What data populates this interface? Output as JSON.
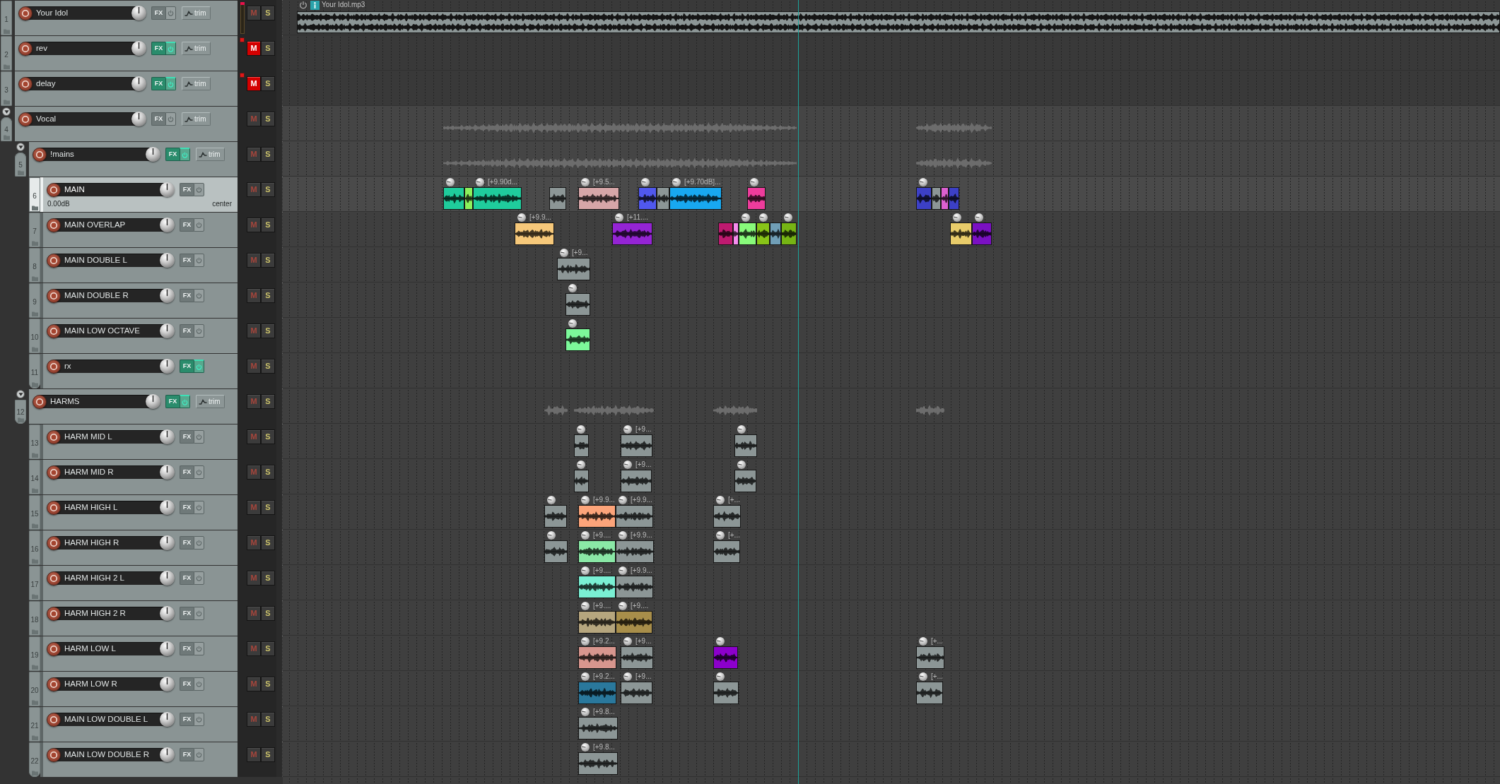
{
  "tracks": [
    {
      "number": "1",
      "name": "Your Idol",
      "selected": false,
      "meter": true,
      "clip": true,
      "fx": {
        "label": "FX",
        "on": false
      },
      "trim": {
        "label": "trim"
      },
      "mute": {
        "label": "M",
        "on": false
      },
      "solo": {
        "label": "S",
        "on": false
      },
      "items": [
        {
          "kind": "take",
          "label": "Your Idol.mp3",
          "color": "#8c9696"
        }
      ]
    },
    {
      "number": "2",
      "name": "rev",
      "selected": false,
      "meter": false,
      "clip": true,
      "fx": {
        "label": "FX",
        "on": true
      },
      "trim": {
        "label": "trim"
      },
      "mute": {
        "label": "M",
        "on": true
      },
      "solo": {
        "label": "S",
        "on": false
      }
    },
    {
      "number": "3",
      "name": "delay",
      "selected": false,
      "meter": false,
      "clip": true,
      "fx": {
        "label": "FX",
        "on": true
      },
      "trim": {
        "label": "trim"
      },
      "mute": {
        "label": "M",
        "on": true
      },
      "solo": {
        "label": "S",
        "on": false
      }
    },
    {
      "number": "4",
      "name": "Vocal",
      "selected": false,
      "expanded": true,
      "meter": false,
      "clip": false,
      "fx": {
        "label": "FX",
        "on": false
      },
      "trim": {
        "label": "trim"
      },
      "mute": {
        "label": "M",
        "on": false
      },
      "solo": {
        "label": "S",
        "on": false
      },
      "children": [
        {
          "number": "5",
          "name": "!mains",
          "selected": false,
          "expanded": true,
          "meter": false,
          "clip": false,
          "fx": {
            "label": "FX",
            "on": true
          },
          "trim": {
            "label": "trim"
          },
          "mute": {
            "label": "M",
            "on": false
          },
          "solo": {
            "label": "S",
            "on": false
          },
          "children": [
            {
              "number": "6",
              "name": "MAIN",
              "selected": true,
              "volume": "0.00dB",
              "pan": "center",
              "meter": false,
              "clip": false,
              "fx": {
                "label": "FX",
                "on": false
              },
              "mute": {
                "label": "M",
                "on": false
              },
              "solo": {
                "label": "S",
                "on": false
              },
              "items": [
                {
                  "kind": "clip",
                  "color": "#1fcc9c"
                },
                {
                  "kind": "segment",
                  "color": "#8cf05c"
                },
                {
                  "kind": "clip",
                  "label": "[+9.90d...",
                  "color": "#1fcc9c"
                },
                {
                  "kind": "segment",
                  "color": "#8c9696"
                },
                {
                  "kind": "clip",
                  "label": "[+9.5...",
                  "color": "#d6a6a8"
                },
                {
                  "kind": "clip",
                  "color": "#5058ee"
                },
                {
                  "kind": "segment",
                  "color": "#8c9696"
                },
                {
                  "kind": "clip",
                  "label": "[+9.70dB]...",
                  "color": "#18a8f0"
                },
                {
                  "kind": "clip",
                  "color": "#ee3c9c"
                },
                {
                  "kind": "clip",
                  "color": "#3c40c6"
                },
                {
                  "kind": "segment",
                  "color": "#8c9696"
                },
                {
                  "kind": "segment",
                  "color": "#dc60d0"
                },
                {
                  "kind": "segment",
                  "color": "#3c40c6"
                }
              ]
            },
            {
              "number": "7",
              "name": "MAIN OVERLAP",
              "selected": false,
              "meter": false,
              "clip": false,
              "fx": {
                "label": "FX",
                "on": false
              },
              "mute": {
                "label": "M",
                "on": false
              },
              "solo": {
                "label": "S",
                "on": false
              },
              "items": [
                {
                  "kind": "clip",
                  "label": "[+9.9...",
                  "color": "#f6c87a"
                },
                {
                  "kind": "clip",
                  "label": "[+11....",
                  "color": "#9424d4"
                },
                {
                  "kind": "segment",
                  "color": "#be1a70"
                },
                {
                  "kind": "segment",
                  "color": "#f68cee"
                },
                {
                  "kind": "clip",
                  "color": "#88fa7a"
                },
                {
                  "kind": "clip",
                  "color": "#88c418"
                },
                {
                  "kind": "segment",
                  "color": "#709eb6"
                },
                {
                  "kind": "clip",
                  "color": "#76b414"
                },
                {
                  "kind": "clip",
                  "color": "#e8cc6a"
                },
                {
                  "kind": "clip",
                  "color": "#7a10c2"
                }
              ]
            },
            {
              "number": "8",
              "name": "MAIN DOUBLE L",
              "selected": false,
              "meter": false,
              "clip": false,
              "fx": {
                "label": "FX",
                "on": false
              },
              "mute": {
                "label": "M",
                "on": false
              },
              "solo": {
                "label": "S",
                "on": false
              },
              "items": [
                {
                  "kind": "clip",
                  "label": "[+9...",
                  "color": "#8c9696"
                }
              ]
            },
            {
              "number": "9",
              "name": "MAIN DOUBLE R",
              "selected": false,
              "meter": false,
              "clip": false,
              "fx": {
                "label": "FX",
                "on": false
              },
              "mute": {
                "label": "M",
                "on": false
              },
              "solo": {
                "label": "S",
                "on": false
              },
              "items": [
                {
                  "kind": "clip",
                  "color": "#8c9696"
                }
              ]
            },
            {
              "number": "10",
              "name": "MAIN LOW OCTAVE",
              "selected": false,
              "meter": false,
              "clip": false,
              "fx": {
                "label": "FX",
                "on": false
              },
              "mute": {
                "label": "M",
                "on": false
              },
              "solo": {
                "label": "S",
                "on": false
              },
              "items": [
                {
                  "kind": "clip",
                  "color": "#7cf89a"
                }
              ]
            },
            {
              "number": "11",
              "name": "rx",
              "selected": false,
              "meter": false,
              "clip": false,
              "fx": {
                "label": "FX",
                "on": true
              },
              "mute": {
                "label": "M",
                "on": false
              },
              "solo": {
                "label": "S",
                "on": false
              }
            }
          ]
        },
        {
          "number": "12",
          "name": "HARMS",
          "selected": false,
          "expanded": true,
          "meter": false,
          "clip": false,
          "fx": {
            "label": "FX",
            "on": true
          },
          "trim": {
            "label": "trim"
          },
          "mute": {
            "label": "M",
            "on": false
          },
          "solo": {
            "label": "S",
            "on": false
          },
          "children": [
            {
              "number": "13",
              "name": "HARM MID L",
              "selected": false,
              "meter": false,
              "clip": false,
              "fx": {
                "label": "FX",
                "on": false
              },
              "mute": {
                "label": "M",
                "on": false
              },
              "solo": {
                "label": "S",
                "on": false
              },
              "items": [
                {
                  "kind": "clip",
                  "color": "#8c9696"
                },
                {
                  "kind": "clip",
                  "label": "[+9...",
                  "color": "#8c9696"
                },
                {
                  "kind": "clip",
                  "color": "#8c9696"
                }
              ]
            },
            {
              "number": "14",
              "name": "HARM MID R",
              "selected": false,
              "meter": false,
              "clip": false,
              "fx": {
                "label": "FX",
                "on": false
              },
              "mute": {
                "label": "M",
                "on": false
              },
              "solo": {
                "label": "S",
                "on": false
              },
              "items": [
                {
                  "kind": "clip",
                  "color": "#8c9696"
                },
                {
                  "kind": "clip",
                  "label": "[+9...",
                  "color": "#8c9696"
                },
                {
                  "kind": "clip",
                  "color": "#8c9696"
                }
              ]
            },
            {
              "number": "15",
              "name": "HARM HIGH L",
              "selected": false,
              "meter": false,
              "clip": false,
              "fx": {
                "label": "FX",
                "on": false
              },
              "mute": {
                "label": "M",
                "on": false
              },
              "solo": {
                "label": "S",
                "on": false
              },
              "items": [
                {
                  "kind": "clip",
                  "color": "#8c9696"
                },
                {
                  "kind": "clip",
                  "label": "[+9.9...",
                  "color": "#fca47a"
                },
                {
                  "kind": "clip",
                  "label": "[+9.9...",
                  "color": "#8c9696"
                },
                {
                  "kind": "clip",
                  "label": "[+...",
                  "color": "#8c9696"
                }
              ]
            },
            {
              "number": "16",
              "name": "HARM HIGH R",
              "selected": false,
              "meter": false,
              "clip": false,
              "fx": {
                "label": "FX",
                "on": false
              },
              "mute": {
                "label": "M",
                "on": false
              },
              "solo": {
                "label": "S",
                "on": false
              },
              "items": [
                {
                  "kind": "clip",
                  "color": "#8c9696"
                },
                {
                  "kind": "clip",
                  "label": "[+9....",
                  "color": "#8ae8a6"
                },
                {
                  "kind": "clip",
                  "label": "[+9.9...",
                  "color": "#8c9696"
                },
                {
                  "kind": "clip",
                  "label": "[+...",
                  "color": "#8c9696"
                }
              ]
            },
            {
              "number": "17",
              "name": "HARM HIGH 2 L",
              "selected": false,
              "meter": false,
              "clip": false,
              "fx": {
                "label": "FX",
                "on": false
              },
              "mute": {
                "label": "M",
                "on": false
              },
              "solo": {
                "label": "S",
                "on": false
              },
              "items": [
                {
                  "kind": "clip",
                  "label": "[+9....",
                  "color": "#7af0d4"
                },
                {
                  "kind": "clip",
                  "label": "[+9.9...",
                  "color": "#8c9696"
                }
              ]
            },
            {
              "number": "18",
              "name": "HARM HIGH 2 R",
              "selected": false,
              "meter": false,
              "clip": false,
              "fx": {
                "label": "FX",
                "on": false
              },
              "mute": {
                "label": "M",
                "on": false
              },
              "solo": {
                "label": "S",
                "on": false
              },
              "items": [
                {
                  "kind": "clip",
                  "label": "[+9....",
                  "color": "#b6a67e"
                },
                {
                  "kind": "clip",
                  "label": "[+9....",
                  "color": "#a88e4a"
                }
              ]
            },
            {
              "number": "19",
              "name": "HARM LOW L",
              "selected": false,
              "meter": false,
              "clip": false,
              "fx": {
                "label": "FX",
                "on": false
              },
              "mute": {
                "label": "M",
                "on": false
              },
              "solo": {
                "label": "S",
                "on": false
              },
              "items": [
                {
                  "kind": "clip",
                  "label": "[+9.2...",
                  "color": "#d8968e"
                },
                {
                  "kind": "clip",
                  "label": "[+9...",
                  "color": "#8c9696"
                },
                {
                  "kind": "clip",
                  "color": "#8c00cc"
                },
                {
                  "kind": "clip",
                  "label": "[+...",
                  "color": "#8c9696"
                }
              ]
            },
            {
              "number": "20",
              "name": "HARM LOW R",
              "selected": false,
              "meter": false,
              "clip": false,
              "fx": {
                "label": "FX",
                "on": false
              },
              "mute": {
                "label": "M",
                "on": false
              },
              "solo": {
                "label": "S",
                "on": false
              },
              "items": [
                {
                  "kind": "clip",
                  "label": "[+9.2...",
                  "color": "#2a789c"
                },
                {
                  "kind": "clip",
                  "label": "[+9...",
                  "color": "#8c9696"
                },
                {
                  "kind": "clip",
                  "color": "#8c9696"
                },
                {
                  "kind": "clip",
                  "label": "[+...",
                  "color": "#8c9696"
                }
              ]
            },
            {
              "number": "21",
              "name": "MAIN LOW DOUBLE L",
              "selected": false,
              "meter": false,
              "clip": false,
              "fx": {
                "label": "FX",
                "on": false
              },
              "mute": {
                "label": "M",
                "on": false
              },
              "solo": {
                "label": "S",
                "on": false
              },
              "items": [
                {
                  "kind": "clip",
                  "label": "[+9.8...",
                  "color": "#8c9696"
                }
              ]
            },
            {
              "number": "22",
              "name": "MAIN LOW DOUBLE R",
              "selected": false,
              "meter": false,
              "clip": false,
              "fx": {
                "label": "FX",
                "on": false
              },
              "mute": {
                "label": "M",
                "on": false
              },
              "solo": {
                "label": "S",
                "on": false
              },
              "items": [
                {
                  "kind": "clip",
                  "label": "[+9.8...",
                  "color": "#8c9696"
                }
              ]
            }
          ]
        }
      ]
    }
  ]
}
